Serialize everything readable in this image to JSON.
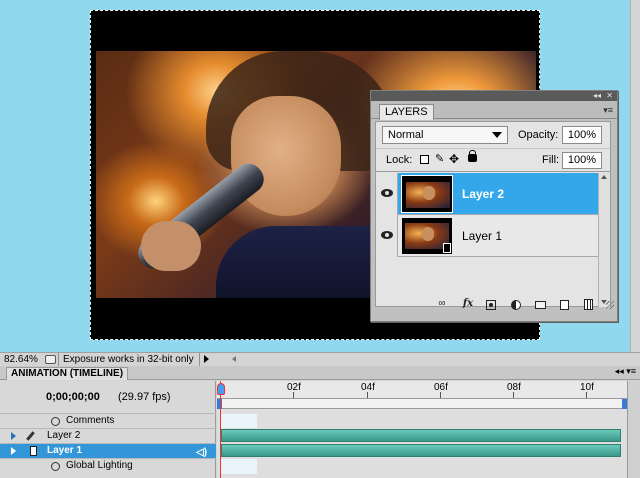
{
  "status_bar": {
    "zoom": "82.64%",
    "message": "Exposure works in 32-bit only"
  },
  "layers_panel": {
    "tab_label": "LAYERS",
    "blend_mode": "Normal",
    "opacity_label": "Opacity:",
    "opacity_value": "100%",
    "lock_label": "Lock:",
    "fill_label": "Fill:",
    "fill_value": "100%",
    "layers": [
      {
        "name": "Layer 2",
        "selected": true,
        "visible": true
      },
      {
        "name": "Layer 1",
        "selected": false,
        "visible": true,
        "is_video": true
      }
    ],
    "footer_icons": [
      "link-icon",
      "fx-icon",
      "mask-icon",
      "adjustment-icon",
      "group-icon",
      "new-layer-icon",
      "trash-icon"
    ]
  },
  "timeline": {
    "title": "ANIMATION (TIMELINE)",
    "timecode": "0;00;00;00",
    "fps": "(29.97 fps)",
    "ruler_labels": [
      "02f",
      "04f",
      "06f",
      "08f",
      "10f"
    ],
    "rows": [
      {
        "label": "Comments"
      },
      {
        "label": "Layer 2"
      },
      {
        "label": "Layer 1",
        "selected": true
      },
      {
        "label": "Global Lighting"
      }
    ]
  },
  "colors": {
    "workspace_bg": "#8fd8ee",
    "selection_blue": "#33a7ea",
    "track_teal": "#4aae9c",
    "playhead_red": "#e33333"
  }
}
